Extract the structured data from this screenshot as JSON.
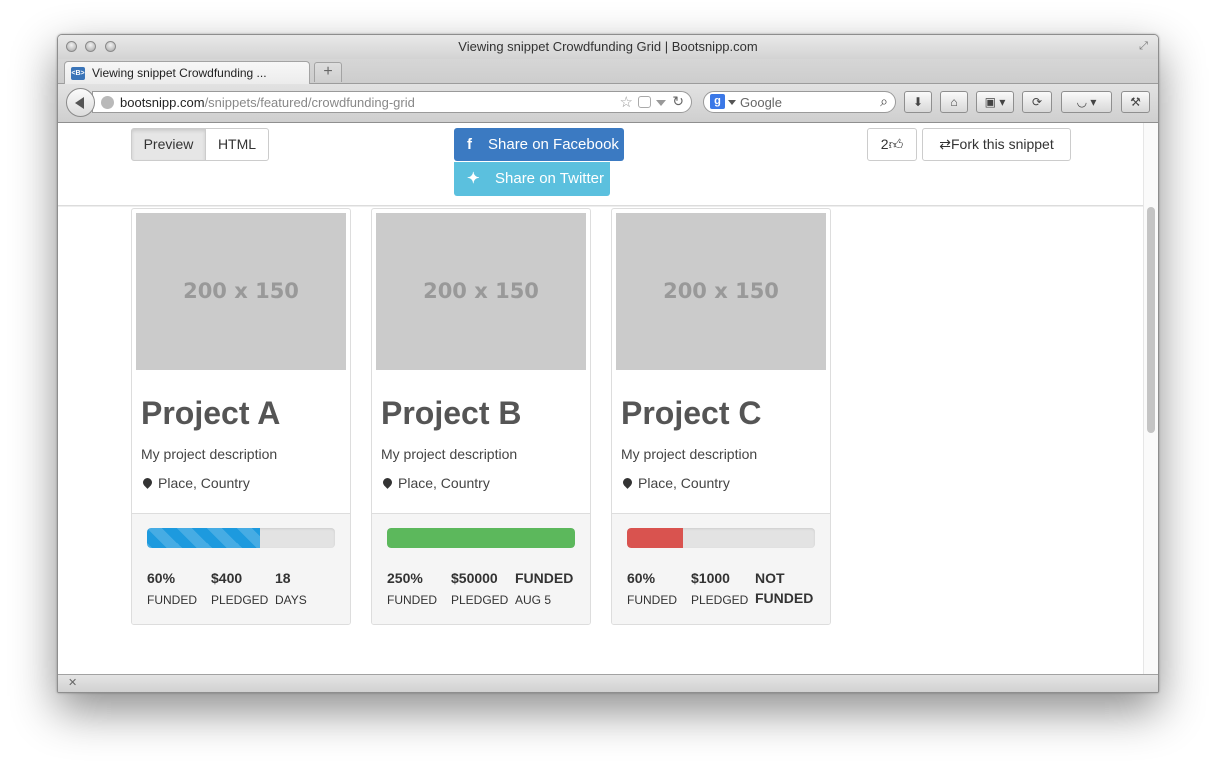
{
  "window": {
    "title": "Viewing snippet Crowdfunding Grid | Bootsnipp.com"
  },
  "tab": {
    "label": "Viewing snippet Crowdfunding ...",
    "favicon": "<B>",
    "new_tab": "+"
  },
  "urlbar": {
    "domain": "bootsnipp.com",
    "path": "/snippets/featured/crowdfunding-grid"
  },
  "search": {
    "placeholder": "Google",
    "engine_badge": "g"
  },
  "page": {
    "preview_label": "Preview",
    "html_label": "HTML",
    "share_facebook": "Share on Facebook",
    "share_twitter": "Share on Twitter",
    "like_count": "2",
    "fork_label": "Fork this snippet",
    "colors": {
      "facebook": "#3b7ac2",
      "twitter": "#5bc0de"
    }
  },
  "cards": [
    {
      "thumb": "200 x 150",
      "title": "Project A",
      "description": "My project description",
      "location": "Place, Country",
      "progress": {
        "percent": 60,
        "color": "#1d9ade",
        "style": "striped"
      },
      "stats": [
        {
          "value": "60%",
          "label": "FUNDED"
        },
        {
          "value": "$400",
          "label": "PLEDGED"
        },
        {
          "value": "18",
          "label": "DAYS"
        }
      ]
    },
    {
      "thumb": "200 x 150",
      "title": "Project B",
      "description": "My project description",
      "location": "Place, Country",
      "progress": {
        "percent": 100,
        "color": "#5cb85c",
        "style": "solid"
      },
      "stats": [
        {
          "value": "250%",
          "label": "FUNDED"
        },
        {
          "value": "$50000",
          "label": "PLEDGED"
        },
        {
          "value": "FUNDED",
          "label": "AUG 5"
        }
      ]
    },
    {
      "thumb": "200 x 150",
      "title": "Project C",
      "description": "My project description",
      "location": "Place, Country",
      "progress": {
        "percent": 30,
        "color": "#d9534f",
        "style": "solid"
      },
      "stats": [
        {
          "value": "60%",
          "label": "FUNDED"
        },
        {
          "value": "$1000",
          "label": "PLEDGED"
        },
        {
          "value": "NOT",
          "label": "FUNDED"
        }
      ]
    }
  ]
}
